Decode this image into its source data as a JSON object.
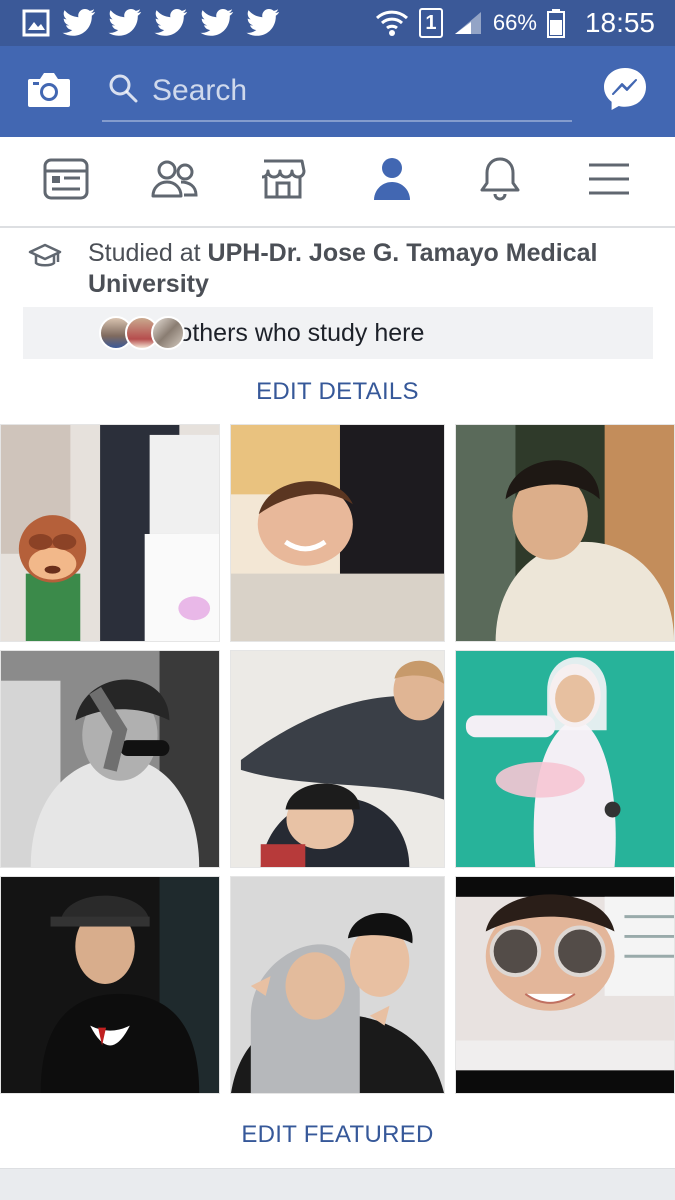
{
  "status_bar": {
    "battery": "66%",
    "time": "18:55",
    "sim_slot": "1",
    "notification_icons": [
      "gallery-icon",
      "twitter-icon",
      "twitter-icon",
      "twitter-icon",
      "twitter-icon",
      "twitter-icon"
    ]
  },
  "app_bar": {
    "search_placeholder": "Search",
    "bg_color": "#4267b2",
    "status_color": "#3b5998"
  },
  "nav_tabs": [
    {
      "icon": "news-feed-icon",
      "active": false
    },
    {
      "icon": "friends-icon",
      "active": false
    },
    {
      "icon": "marketplace-icon",
      "active": false
    },
    {
      "icon": "profile-icon",
      "active": true
    },
    {
      "icon": "notifications-bell-icon",
      "active": false
    },
    {
      "icon": "menu-icon",
      "active": false
    }
  ],
  "education": {
    "prefix": "Studied at ",
    "school": "UPH-Dr. Jose G. Tamayo Medical University",
    "see_others": "See others who study here"
  },
  "edit_details": "EDIT DETAILS",
  "edit_featured": "EDIT FEATURED",
  "featured_photos": [
    "Child covering eyes (monkey emoji) at a store",
    "Smiling young man lying down",
    "Young man in white jacket outdoors",
    "Black and white photo of man touching hair",
    "Two young men, one in cap",
    "Young man in white hoodie on green background",
    "Young man in black cap and black t-shirt",
    "Two young men making V signs",
    "Young man in round sunglasses smiling"
  ],
  "accent_color": "#365899"
}
